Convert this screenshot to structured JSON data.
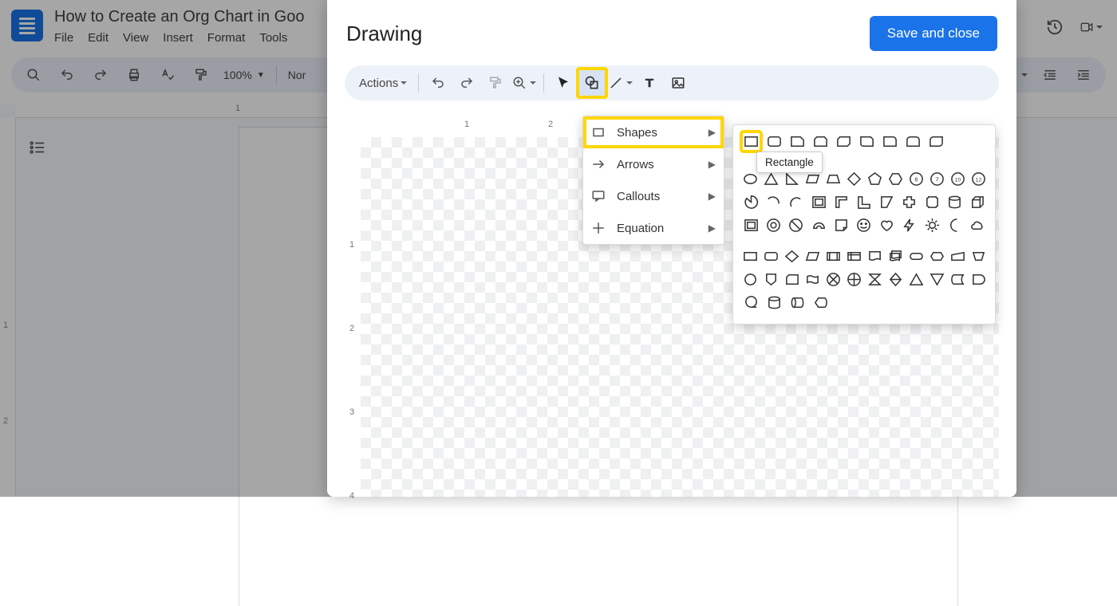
{
  "doc": {
    "title": "How to Create an Org Chart in Goo",
    "menus": [
      "File",
      "Edit",
      "View",
      "Insert",
      "Format",
      "Tools"
    ],
    "toolbar_zoom": "100%",
    "toolbar_style": "Nor",
    "ruler_h_marks": [
      "1"
    ],
    "ruler_v_marks": [
      "1",
      "2"
    ]
  },
  "drawing": {
    "title": "Drawing",
    "save_label": "Save and close",
    "actions_label": "Actions",
    "ruler_h_marks": [
      "1",
      "2"
    ],
    "ruler_v_marks": [
      "1",
      "2",
      "3",
      "4"
    ]
  },
  "shape_menu": {
    "items": [
      {
        "label": "Shapes"
      },
      {
        "label": "Arrows"
      },
      {
        "label": "Callouts"
      },
      {
        "label": "Equation"
      }
    ]
  },
  "tooltip": {
    "text": "Rectangle"
  }
}
